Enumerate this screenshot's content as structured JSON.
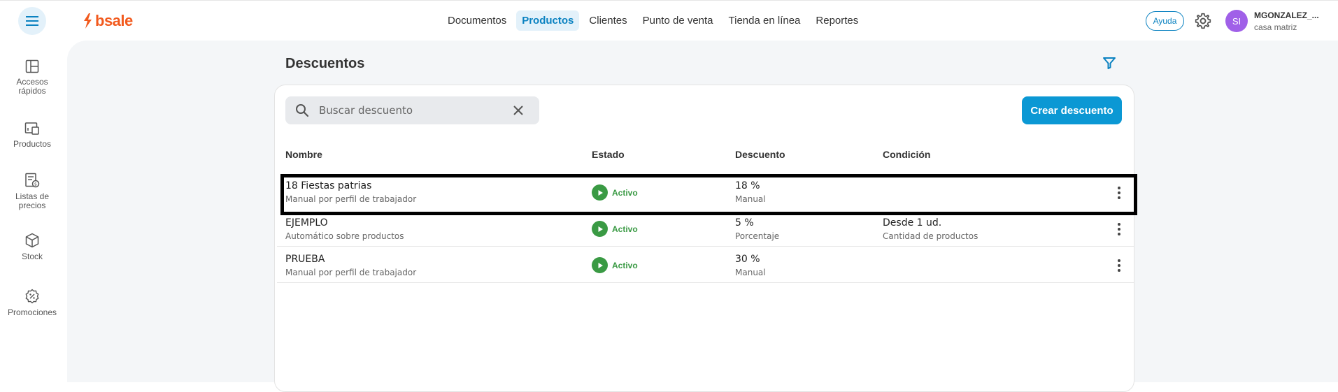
{
  "header": {
    "logo_text": "bsale",
    "nav": [
      {
        "label": "Documentos",
        "active": false
      },
      {
        "label": "Productos",
        "active": true
      },
      {
        "label": "Clientes",
        "active": false
      },
      {
        "label": "Punto de venta",
        "active": false
      },
      {
        "label": "Tienda en línea",
        "active": false
      },
      {
        "label": "Reportes",
        "active": false
      }
    ],
    "help_label": "Ayuda",
    "avatar_initials": "SI",
    "user_name": "MGONZALEZ_...",
    "user_branch": "casa matriz"
  },
  "sidebar": {
    "items": [
      {
        "label": "Accesos rápidos",
        "icon": "quick-access-icon"
      },
      {
        "label": "Productos",
        "icon": "products-icon"
      },
      {
        "label": "Listas de precios",
        "icon": "price-list-icon"
      },
      {
        "label": "Stock",
        "icon": "stock-icon"
      },
      {
        "label": "Promociones",
        "icon": "promotions-icon"
      }
    ]
  },
  "main": {
    "title": "Descuentos",
    "search_placeholder": "Buscar descuento",
    "create_label": "Crear descuento",
    "columns": [
      "Nombre",
      "Estado",
      "Descuento",
      "Condición"
    ],
    "rows": [
      {
        "name": "18 Fiestas patrias",
        "type": "Manual por perfil de trabajador",
        "status": "Activo",
        "discount": "18 %",
        "discount_type": "Manual",
        "condition": "",
        "condition_sub": "",
        "highlighted": true
      },
      {
        "name": "EJEMPLO",
        "type": "Automático sobre productos",
        "status": "Activo",
        "discount": "5 %",
        "discount_type": "Porcentaje",
        "condition": "Desde 1 ud.",
        "condition_sub": "Cantidad de productos",
        "highlighted": false
      },
      {
        "name": "PRUEBA",
        "type": "Manual por perfil de trabajador",
        "status": "Activo",
        "discount": "30 %",
        "discount_type": "Manual",
        "condition": "",
        "condition_sub": "",
        "highlighted": false
      }
    ]
  },
  "colors": {
    "accent": "#0b98d4",
    "active_green": "#3a9a44",
    "brand": "#f25a1e",
    "avatar": "#a060e8"
  }
}
